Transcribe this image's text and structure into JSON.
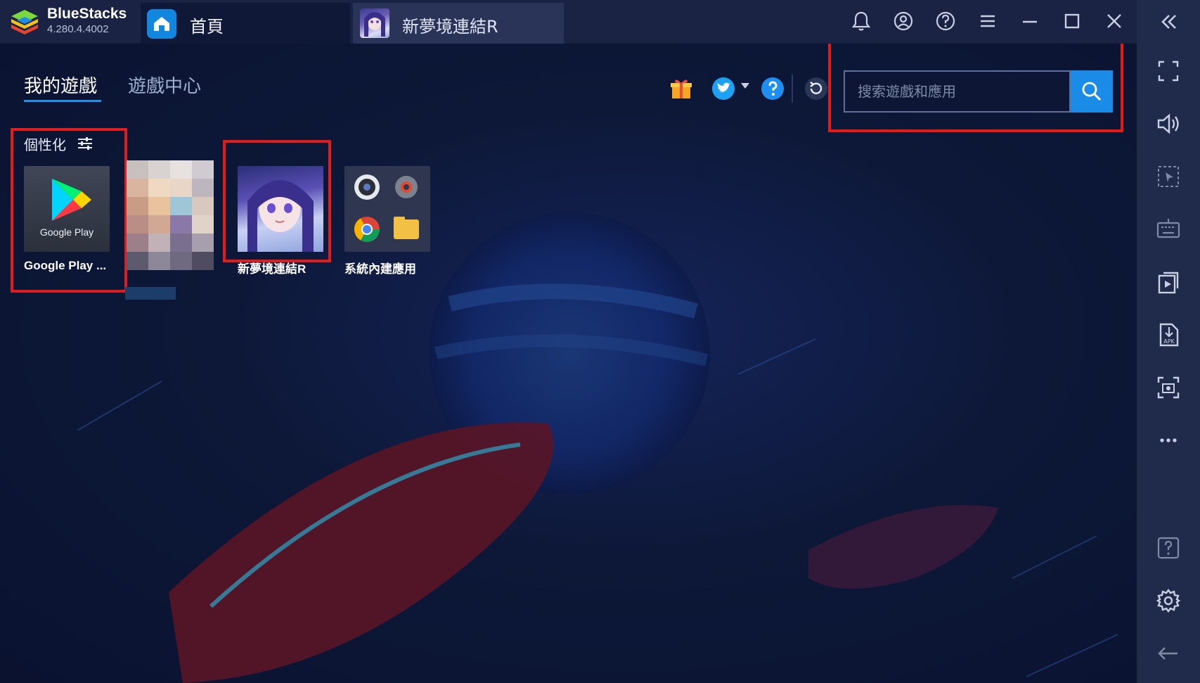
{
  "app": {
    "name": "BlueStacks",
    "version": "4.280.4.4002",
    "logo_icon": "bluestacks-logo-icon"
  },
  "tabs": [
    {
      "label": "首頁",
      "icon": "home-icon",
      "active": true
    },
    {
      "label": "新夢境連結R",
      "icon": "game-thumbnail-icon",
      "active": false
    }
  ],
  "titlebar_icons": [
    "bell-icon",
    "account-icon",
    "help-icon",
    "menu-icon",
    "minimize-icon",
    "maximize-icon",
    "close-icon"
  ],
  "sidebar_icons": [
    "collapse-icon",
    "fullscreen-icon",
    "volume-icon",
    "cursor-select-icon",
    "keyboard-icon",
    "media-import-icon",
    "apk-install-icon",
    "screenshot-icon",
    "more-icon",
    "help-icon",
    "settings-icon",
    "back-icon"
  ],
  "nav": {
    "my_games": "我的遊戲",
    "game_center": "遊戲中心"
  },
  "header_icons": [
    "gift-icon",
    "twitter-icon",
    "help-icon",
    "refresh-icon"
  ],
  "search": {
    "placeholder": "搜索遊戲和應用"
  },
  "personalize": {
    "label": "個性化",
    "icon": "sliders-icon"
  },
  "apps": [
    {
      "label": "Google Play ...",
      "tile_text": "Google Play",
      "icon": "google-play-icon"
    },
    {
      "label": "",
      "icon": "pixelated-app-icon"
    },
    {
      "label": "新夢境連結R",
      "icon": "game-icon"
    },
    {
      "label": "系統內建應用",
      "icon": "system-apps-folder-icon"
    }
  ],
  "colors": {
    "accent": "#1a8ce8",
    "highlight": "#e21b1b",
    "titlebar": "#1a2343",
    "sidebar": "#202a4a",
    "background": "#0d1736"
  }
}
